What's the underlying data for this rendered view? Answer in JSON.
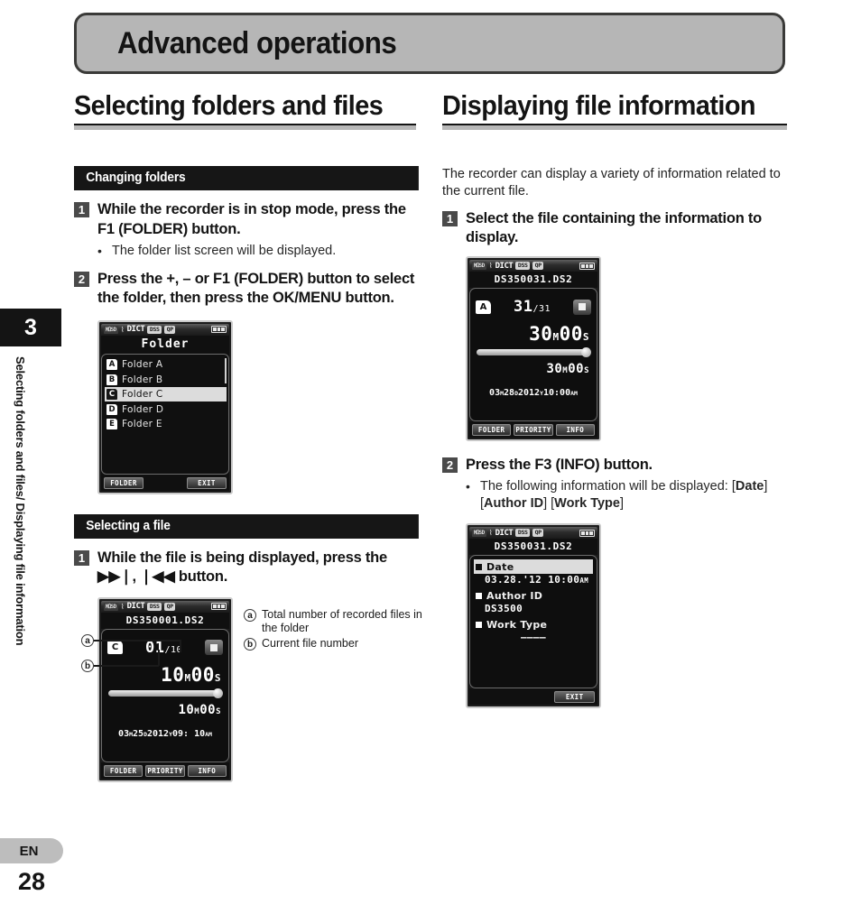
{
  "chapter": {
    "title": "Advanced operations",
    "number": "3"
  },
  "sidebar": {
    "running_head": "Selecting folders and files/ Displaying file information"
  },
  "footer": {
    "language": "EN",
    "page_number": "28"
  },
  "left_column": {
    "heading": "Selecting folders and files",
    "section_1": {
      "bar_label": "Changing folders",
      "steps": [
        {
          "number": "1",
          "text_parts": [
            {
              "t": "While the recorder is in stop mode, press the ",
              "b": false
            },
            {
              "t": "F1",
              "b": true
            },
            {
              "t": " (",
              "b": false
            },
            {
              "t": "FOLDER",
              "b": true
            },
            {
              "t": ") button.",
              "b": false
            }
          ],
          "bullets": [
            {
              "dot": "•",
              "parts": [
                {
                  "t": "The folder list screen will be displayed.",
                  "b": false
                }
              ]
            }
          ]
        },
        {
          "number": "2",
          "text_parts": [
            {
              "t": "Press the +, – or ",
              "b": false
            },
            {
              "t": "F1",
              "b": true
            },
            {
              "t": " (",
              "b": false
            },
            {
              "t": "FOLDER",
              "b": true
            },
            {
              "t": ") button to select the folder, then press the ",
              "b": false
            },
            {
              "t": "OK/MENU",
              "b": true
            },
            {
              "t": " button.",
              "b": false
            }
          ],
          "bullets": []
        }
      ],
      "screen": {
        "type": "folder-list",
        "status": {
          "sd": "㏁SD",
          "mic": "⌇",
          "dict": "DICT",
          "badge1": "DSS",
          "badge2": "QP",
          "battery": "full"
        },
        "title": "Folder",
        "items": [
          {
            "icon": "A",
            "label": "Folder A",
            "selected": false
          },
          {
            "icon": "B",
            "label": "Folder B",
            "selected": false
          },
          {
            "icon": "C",
            "label": "Folder C",
            "selected": true
          },
          {
            "icon": "D",
            "label": "Folder D",
            "selected": false
          },
          {
            "icon": "E",
            "label": "Folder E",
            "selected": false
          }
        ],
        "soft_keys": [
          "FOLDER",
          "",
          "EXIT"
        ]
      }
    },
    "section_2": {
      "bar_label": "Selecting a file",
      "steps": [
        {
          "number": "1",
          "text_parts": [
            {
              "t": "While the file is being displayed, press the ▶▶❘, ❘◀◀ button.",
              "b": false
            }
          ],
          "bullets": []
        }
      ],
      "screen": {
        "type": "playback",
        "status": {
          "sd": "㏁SD",
          "mic": "⌇",
          "dict": "DICT",
          "badge1": "DSS",
          "badge2": "QP",
          "battery": "full"
        },
        "filename": "DS350001.DS2",
        "folder": "C",
        "current_file": "01",
        "separator": "/",
        "total_files": "10",
        "transport_state": "stop",
        "elapsed_value": "10",
        "elapsed_unit_m": "M",
        "elapsed_value2": "00",
        "elapsed_unit_s": "S",
        "total_value": "10",
        "total_unit_m": "M",
        "total_value2": "00",
        "total_unit_s": "S",
        "progress_percent": 100,
        "date": {
          "month": "03",
          "month_unit": "M",
          "day": "25",
          "day_unit": "D",
          "year": "2012",
          "year_unit": "Y",
          "time": "09: 10",
          "ampm": "AM"
        },
        "soft_keys": [
          "FOLDER",
          "PRIORITY",
          "INFO"
        ]
      },
      "callouts": [
        {
          "mark": "a",
          "text": "Total number of recorded files in the folder"
        },
        {
          "mark": "b",
          "text": "Current file number"
        }
      ]
    }
  },
  "right_column": {
    "heading": "Displaying file information",
    "intro": "The recorder can display a variety of information related to the current file.",
    "steps": [
      {
        "number": "1",
        "text_parts": [
          {
            "t": "Select the file containing the information to display.",
            "b": false
          }
        ],
        "bullets": []
      },
      {
        "number": "2",
        "text_parts": [
          {
            "t": "Press the ",
            "b": false
          },
          {
            "t": "F3",
            "b": true
          },
          {
            "t": " (",
            "b": false
          },
          {
            "t": "INFO",
            "b": true
          },
          {
            "t": ") button.",
            "b": false
          }
        ],
        "bullets": [
          {
            "dot": "•",
            "parts": [
              {
                "t": "The following information will be displayed: [",
                "b": false
              },
              {
                "t": "Date",
                "b": true
              },
              {
                "t": "] [",
                "b": false
              },
              {
                "t": "Author ID",
                "b": true
              },
              {
                "t": "] [",
                "b": false
              },
              {
                "t": "Work Type",
                "b": true
              },
              {
                "t": "]",
                "b": false
              }
            ]
          }
        ]
      }
    ],
    "screen_1": {
      "type": "playback",
      "status": {
        "sd": "㏁SD",
        "mic": "⌇",
        "dict": "DICT",
        "badge1": "DSS",
        "badge2": "QP",
        "battery": "full"
      },
      "filename": "DS350031.DS2",
      "folder": "A",
      "current_file": "31",
      "separator": "/",
      "total_files": "31",
      "transport_state": "stop",
      "elapsed_value": "30",
      "elapsed_unit_m": "M",
      "elapsed_value2": "00",
      "elapsed_unit_s": "S",
      "total_value": "30",
      "total_unit_m": "M",
      "total_value2": "00",
      "total_unit_s": "S",
      "progress_percent": 100,
      "date": {
        "month": "03",
        "month_unit": "M",
        "day": "28",
        "day_unit": "D",
        "year": "2012",
        "year_unit": "Y",
        "time": "10:00",
        "ampm": "AM"
      },
      "soft_keys": [
        "FOLDER",
        "PRIORITY",
        "INFO"
      ]
    },
    "screen_2": {
      "type": "info-list",
      "status": {
        "sd": "㏁SD",
        "mic": "⌇",
        "dict": "DICT",
        "badge1": "DSS",
        "badge2": "QP",
        "battery": "full"
      },
      "filename": "DS350031.DS2",
      "rows": [
        {
          "key": "Date",
          "value": "03.28.'12  10:00",
          "value_suffix": "AM",
          "selected": true,
          "center": false
        },
        {
          "key": "Author ID",
          "value": "DS3500",
          "value_suffix": "",
          "selected": false,
          "center": false
        },
        {
          "key": "Work Type",
          "value": "––––",
          "value_suffix": "",
          "selected": false,
          "center": true
        }
      ],
      "soft_keys": [
        "",
        "",
        "EXIT"
      ]
    }
  },
  "colors": {
    "banner_bg": "#b6b6b6",
    "banner_border": "#3a3a38",
    "section_bar_bg": "#161616",
    "step_num_bg": "#4a4a4a",
    "rule_gray": "#b8b8b8",
    "lcd_bg": "#101010",
    "lcd_select": "#dcdcdc"
  }
}
